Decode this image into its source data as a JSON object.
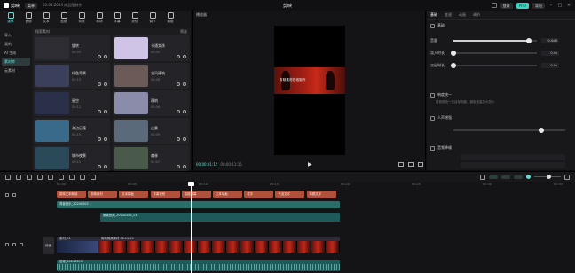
{
  "titlebar": {
    "logo": "剪映",
    "menu": "菜单",
    "project": "03.03.2024 成品图制作",
    "title": "剪映",
    "login": "登录",
    "export": "导出",
    "pro_badge": "PRO",
    "brand_color": "#5fe0d4"
  },
  "toolbar": {
    "tools": [
      {
        "label": "媒体",
        "icon": "media-icon",
        "active": true
      },
      {
        "label": "音频",
        "icon": "audio-icon",
        "active": false
      },
      {
        "label": "文本",
        "icon": "text-icon",
        "active": false
      },
      {
        "label": "贴纸",
        "icon": "sticker-icon",
        "active": false
      },
      {
        "label": "特效",
        "icon": "effects-icon",
        "active": false
      },
      {
        "label": "转场",
        "icon": "transition-icon",
        "active": false
      },
      {
        "label": "字幕",
        "icon": "caption-icon",
        "active": false
      },
      {
        "label": "滤镜",
        "icon": "filter-icon",
        "active": false
      },
      {
        "label": "调节",
        "icon": "adjust-icon",
        "active": false
      },
      {
        "label": "模板",
        "icon": "template-icon",
        "active": false
      }
    ]
  },
  "leftnav": {
    "items": [
      {
        "label": "导入",
        "active": false
      },
      {
        "label": "我的",
        "active": false
      },
      {
        "label": "AI 生成",
        "active": false
      },
      {
        "label": "素材库",
        "active": true
      },
      {
        "label": "云素材",
        "active": false
      }
    ]
  },
  "media": {
    "search_label": "搜索素材",
    "filter_label": "筛选",
    "cards": [
      {
        "title": "旋转",
        "sub": "00:03",
        "thumb": "#2d2d33"
      },
      {
        "title": "卡通女孩",
        "sub": "00:05",
        "thumb": "#cfc3e6"
      },
      {
        "title": "绿色背景",
        "sub": "00:10",
        "thumb": "#3a3f5c"
      },
      {
        "title": "古风建筑",
        "sub": "00:08",
        "thumb": "#6b5a58"
      },
      {
        "title": "星空",
        "sub": "00:12",
        "thumb": "#2a2f4a"
      },
      {
        "title": "建筑",
        "sub": "00:06",
        "thumb": "#8a8caa"
      },
      {
        "title": "海边日落",
        "sub": "00:15",
        "thumb": "#3a6a8a"
      },
      {
        "title": "山景",
        "sub": "00:09",
        "thumb": "#5a6a7a"
      },
      {
        "title": "城市夜景",
        "sub": "00:11",
        "thumb": "#2a4a5a"
      },
      {
        "title": "森林",
        "sub": "00:07",
        "thumb": "#4a5a4a"
      }
    ]
  },
  "player": {
    "title": "播放器",
    "caption": "剪映素材在线制作",
    "timecode_current": "00:00:01:15",
    "timecode_total": "00:00:11:15"
  },
  "inspector": {
    "tabs": [
      {
        "label": "基础",
        "active": true
      },
      {
        "label": "变速",
        "active": false
      },
      {
        "label": "动画",
        "active": false
      },
      {
        "label": "调节",
        "active": false
      }
    ],
    "section_basic": "基础",
    "rows": [
      {
        "label": "音量",
        "value": "0.0dB",
        "level": 0.9
      },
      {
        "label": "淡入时长",
        "value": "0.0s",
        "level": 0.0
      },
      {
        "label": "淡出时长",
        "value": "0.0s",
        "level": 0.0
      }
    ],
    "normalize_label": "响度统一",
    "normalize_note": "将音频统一至目标响度，避免音量忽大忽小",
    "denoise_label": "人声增强",
    "voice_label": "音频降噪"
  },
  "timeline": {
    "ruler": [
      "00:00",
      "00:05",
      "00:10",
      "00:15",
      "00:20",
      "00:25",
      "00:30",
      "00:35"
    ],
    "cover_label": "封面",
    "text_clips": [
      {
        "label": "剪映文本朗读",
        "start": 0.0
      },
      {
        "label": "剪映素材",
        "start": 0.11
      },
      {
        "label": "文本模板",
        "start": 0.22
      },
      {
        "label": "字幕识别",
        "start": 0.33
      },
      {
        "label": "智能字幕",
        "start": 0.44
      },
      {
        "label": "文本动画",
        "start": 0.55
      },
      {
        "label": "花字",
        "start": 0.66
      },
      {
        "label": "气泡文字",
        "start": 0.77
      },
      {
        "label": "标题文字",
        "start": 0.88
      }
    ],
    "audio_clip_1": "朗读音频_20240303_01",
    "main_clip_label": "素材_01",
    "main_clip_label2": "剪映视频素材 00:11:15",
    "audio_clip_2": "背景音乐_20240303",
    "wave_label": "音频_20240303"
  }
}
